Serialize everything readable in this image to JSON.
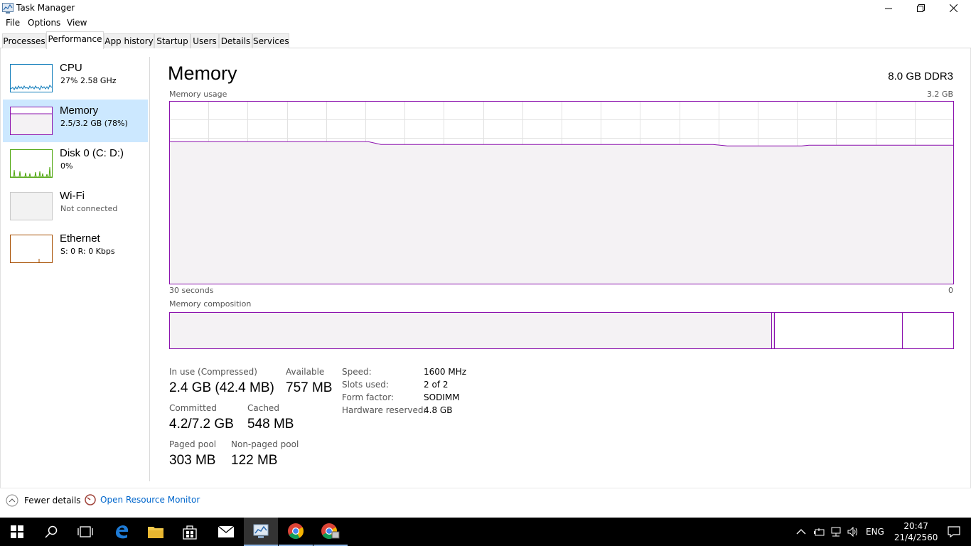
{
  "window": {
    "title": "Task Manager"
  },
  "menu": [
    "File",
    "Options",
    "View"
  ],
  "tabs": [
    "Processes",
    "Performance",
    "App history",
    "Startup",
    "Users",
    "Details",
    "Services"
  ],
  "active_tab": "Performance",
  "sidebar": [
    {
      "name": "CPU",
      "sub": "27% 2.58 GHz",
      "color": "#117dbb"
    },
    {
      "name": "Memory",
      "sub": "2.5/3.2 GB (78%)",
      "color": "#8b12ae"
    },
    {
      "name": "Disk 0 (C: D:)",
      "sub": "0%",
      "color": "#4da60c"
    },
    {
      "name": "Wi-Fi",
      "sub": "Not connected",
      "color": "#a0a0a0"
    },
    {
      "name": "Ethernet",
      "sub": "S: 0 R: 0 Kbps",
      "color": "#a74f01"
    }
  ],
  "main": {
    "title": "Memory",
    "spec": "8.0 GB DDR3",
    "usage_label": "Memory usage",
    "usage_max": "3.2 GB",
    "time_span": "30 seconds",
    "time_zero": "0",
    "composition_label": "Memory composition",
    "usage_fraction": 0.78
  },
  "stats": {
    "in_use_label": "In use (Compressed)",
    "in_use_value": "2.4 GB (42.4 MB)",
    "available_label": "Available",
    "available_value": "757 MB",
    "committed_label": "Committed",
    "committed_value": "4.2/7.2 GB",
    "cached_label": "Cached",
    "cached_value": "548 MB",
    "paged_label": "Paged pool",
    "paged_value": "303 MB",
    "nonpaged_label": "Non-paged pool",
    "nonpaged_value": "122 MB"
  },
  "details": {
    "speed_label": "Speed:",
    "speed_value": "1600 MHz",
    "slots_label": "Slots used:",
    "slots_value": "2 of 2",
    "form_label": "Form factor:",
    "form_value": "SODIMM",
    "hw_label": "Hardware reserved:",
    "hw_value": "4.8 GB"
  },
  "footer": {
    "fewer_details": "Fewer details",
    "open_monitor": "Open Resource Monitor"
  },
  "taskbar": {
    "language": "ENG",
    "time": "20:47",
    "date": "21/4/2560"
  },
  "colors": {
    "memory": "#8b12ae",
    "graph_fill": "#f4f2f4",
    "grid": "#e2e2e2",
    "selected": "#cce8ff",
    "link": "#0066cc"
  }
}
